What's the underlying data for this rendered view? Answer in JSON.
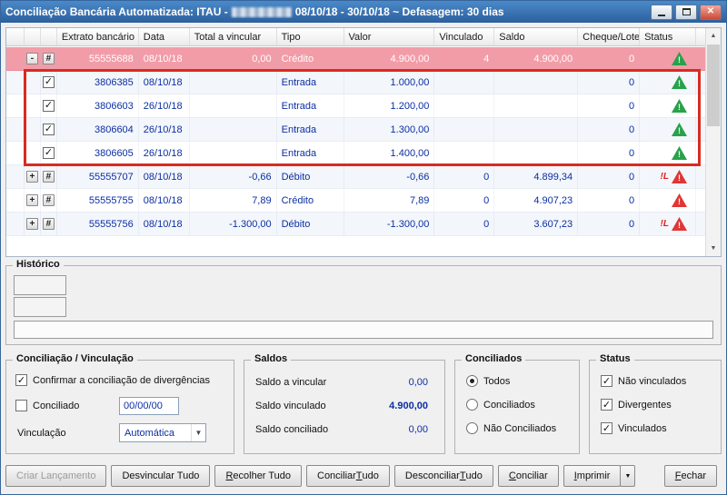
{
  "window": {
    "title_prefix": "Conciliação Bancária Automatizada: ITAU - ",
    "title_suffix": " 08/10/18 - 30/10/18 ~ Defasagem: 30 dias"
  },
  "grid": {
    "columns": [
      "Extrato bancário",
      "Data",
      "Total a vincular",
      "Tipo",
      "Valor",
      "Vinculado",
      "Saldo",
      "Cheque/Lote",
      "Status"
    ],
    "hash_glyph": "#",
    "rows": [
      {
        "kind": "parent",
        "expand": "-",
        "extrato": "55555688",
        "data": "08/10/18",
        "total": "0,00",
        "tipo": "Crédito",
        "valor": "4.900,00",
        "vinculado": "4",
        "saldo": "4.900,00",
        "cheque": "0",
        "flag": "",
        "status": "green",
        "highlight": true
      },
      {
        "kind": "child",
        "checked": true,
        "extrato": "3806385",
        "data": "08/10/18",
        "total": "",
        "tipo": "Entrada",
        "valor": "1.000,00",
        "vinculado": "",
        "saldo": "",
        "cheque": "0",
        "flag": "",
        "status": "green"
      },
      {
        "kind": "child",
        "checked": true,
        "extrato": "3806603",
        "data": "26/10/18",
        "total": "",
        "tipo": "Entrada",
        "valor": "1.200,00",
        "vinculado": "",
        "saldo": "",
        "cheque": "0",
        "flag": "",
        "status": "green"
      },
      {
        "kind": "child",
        "checked": true,
        "extrato": "3806604",
        "data": "26/10/18",
        "total": "",
        "tipo": "Entrada",
        "valor": "1.300,00",
        "vinculado": "",
        "saldo": "",
        "cheque": "0",
        "flag": "",
        "status": "green"
      },
      {
        "kind": "child",
        "checked": true,
        "extrato": "3806605",
        "data": "26/10/18",
        "total": "",
        "tipo": "Entrada",
        "valor": "1.400,00",
        "vinculado": "",
        "saldo": "",
        "cheque": "0",
        "flag": "",
        "status": "green"
      },
      {
        "kind": "parent",
        "expand": "+",
        "extrato": "55555707",
        "data": "08/10/18",
        "total": "-0,66",
        "tipo": "Débito",
        "valor": "-0,66",
        "vinculado": "0",
        "saldo": "4.899,34",
        "cheque": "0",
        "flag": "!L",
        "status": "red"
      },
      {
        "kind": "parent",
        "expand": "+",
        "extrato": "55555755",
        "data": "08/10/18",
        "total": "7,89",
        "tipo": "Crédito",
        "valor": "7,89",
        "vinculado": "0",
        "saldo": "4.907,23",
        "cheque": "0",
        "flag": "",
        "status": "red"
      },
      {
        "kind": "parent",
        "expand": "+",
        "extrato": "55555756",
        "data": "08/10/18",
        "total": "-1.300,00",
        "tipo": "Débito",
        "valor": "-1.300,00",
        "vinculado": "0",
        "saldo": "3.607,23",
        "cheque": "0",
        "flag": "!L",
        "status": "red"
      }
    ]
  },
  "historico": {
    "title": "Histórico"
  },
  "conciliacao": {
    "title": "Conciliação / Vinculação",
    "confirm_label": "Confirmar a conciliação de divergências",
    "confirm_checked": true,
    "conciliado_label": "Conciliado",
    "conciliado_checked": false,
    "conciliado_date": "00/00/00",
    "vinculacao_label": "Vinculação",
    "vinculacao_value": "Automática"
  },
  "saldos": {
    "title": "Saldos",
    "rows": [
      {
        "label": "Saldo a vincular",
        "value": "0,00"
      },
      {
        "label": "Saldo vinculado",
        "value": "4.900,00"
      },
      {
        "label": "Saldo conciliado",
        "value": "0,00"
      }
    ]
  },
  "conciliados": {
    "title": "Conciliados",
    "options": [
      {
        "label": "Todos",
        "selected": true
      },
      {
        "label": "Conciliados",
        "selected": false
      },
      {
        "label": "Não Conciliados",
        "selected": false
      }
    ]
  },
  "status_group": {
    "title": "Status",
    "options": [
      {
        "label": "Não vinculados",
        "checked": true
      },
      {
        "label": "Divergentes",
        "checked": true
      },
      {
        "label": "Vinculados",
        "checked": true
      }
    ]
  },
  "buttons": [
    {
      "name": "criar-lancamento-button",
      "label": "Criar Lançamento",
      "enabled": false,
      "mnemonic": -1
    },
    {
      "name": "desvincular-tudo-button",
      "label": "Desvincular Tudo",
      "enabled": true,
      "mnemonic": -1
    },
    {
      "name": "recolher-tudo-button",
      "label": "Recolher Tudo",
      "enabled": true,
      "mnemonic": 0
    },
    {
      "name": "conciliar-tudo-button",
      "label": "Conciliar Tudo",
      "enabled": true,
      "mnemonic": 10
    },
    {
      "name": "desconciliar-tudo-button",
      "label": "Desconciliar Tudo",
      "enabled": true,
      "mnemonic": 13
    },
    {
      "name": "conciliar-button",
      "label": "Conciliar",
      "enabled": true,
      "mnemonic": 0
    },
    {
      "name": "imprimir-button",
      "label": "Imprimir",
      "enabled": true,
      "mnemonic": 0,
      "split": true
    },
    {
      "name": "fechar-button",
      "label": "Fechar",
      "enabled": true,
      "mnemonic": 0,
      "align_right": true
    }
  ],
  "colors": {
    "titlebar": "#3a74b4",
    "highlight_row": "#f29ca8",
    "ok_icon": "#27a24b",
    "alert_icon": "#e03636",
    "value_text": "#0b2fa3",
    "annotation": "#d92b20"
  }
}
